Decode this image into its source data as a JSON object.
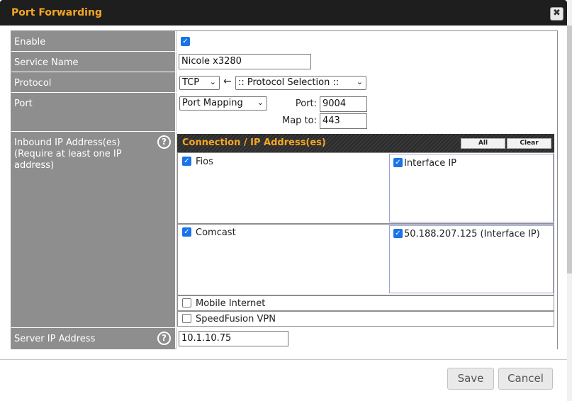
{
  "dialog": {
    "title": "Port Forwarding",
    "close_glyph": "✖"
  },
  "labels": {
    "enable": "Enable",
    "service_name": "Service Name",
    "protocol": "Protocol",
    "port": "Port",
    "inbound": "Inbound IP Address(es)\n(Require at least one IP address)",
    "server_ip": "Server IP Address"
  },
  "fields": {
    "enable_checked": true,
    "service_name": "Nicole x3280",
    "protocol": "TCP",
    "protocol_arrow": "←",
    "protocol_selection": ":: Protocol Selection ::",
    "port_mapping": "Port Mapping",
    "port_label": "Port:",
    "port_value": "9004",
    "map_to_label": "Map to:",
    "map_to_value": "443",
    "server_ip": "10.1.10.75"
  },
  "connections": {
    "header": "Connection / IP Address(es)",
    "all_button": "All",
    "clear_button": "Clear",
    "items": [
      {
        "name": "Fios",
        "checked": true,
        "ip": "Interface IP",
        "ip_checked": true
      },
      {
        "name": "Comcast",
        "checked": true,
        "ip": "50.188.207.125 (Interface IP)",
        "ip_checked": true
      },
      {
        "name": "Mobile Internet",
        "checked": false
      },
      {
        "name": "SpeedFusion VPN",
        "checked": false
      }
    ]
  },
  "help_glyph": "?",
  "check_glyph": "✓",
  "chevron_glyph": "⌄",
  "footer": {
    "save": "Save",
    "cancel": "Cancel"
  },
  "colors": {
    "accent": "#f5a623",
    "label_bg": "#8e8e8e",
    "checkbox": "#1a73e8",
    "titlebar": "#1e1e1e"
  }
}
